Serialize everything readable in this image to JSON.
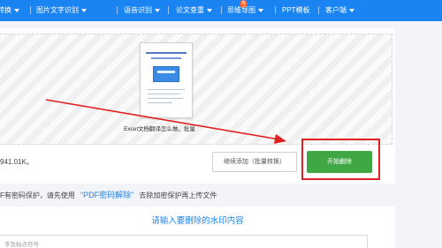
{
  "nav": {
    "items": [
      {
        "label": "转换",
        "has_caret": true
      },
      {
        "label": "图片文字识别",
        "has_caret": true
      },
      {
        "label": "语音识别",
        "has_caret": true
      },
      {
        "label": "论文查重",
        "has_caret": true
      },
      {
        "label": "思维导图",
        "has_caret": true
      },
      {
        "label": "PPT模板",
        "has_caret": false
      },
      {
        "label": "客户端",
        "has_caret": true
      }
    ],
    "badge": "热"
  },
  "upload": {
    "filename": "Excel文档翻译怎么做，批量",
    "file_size_text": "941.01K。",
    "continue_button": "继续添加（批量转换）",
    "start_button": "开始删除"
  },
  "tip": {
    "prefix": "F有密码保护，请先使用",
    "link": "“PDF密码解除”",
    "suffix": "去除加密保护再上传文件"
  },
  "watermark": {
    "title": "请输入要删除的水印内容",
    "input_placeholder": "字及标点符号"
  },
  "colors": {
    "nav_bg": "#1a84f2",
    "accent": "#1a84f2",
    "start_button": "#3fa845",
    "highlight": "#e02020"
  }
}
